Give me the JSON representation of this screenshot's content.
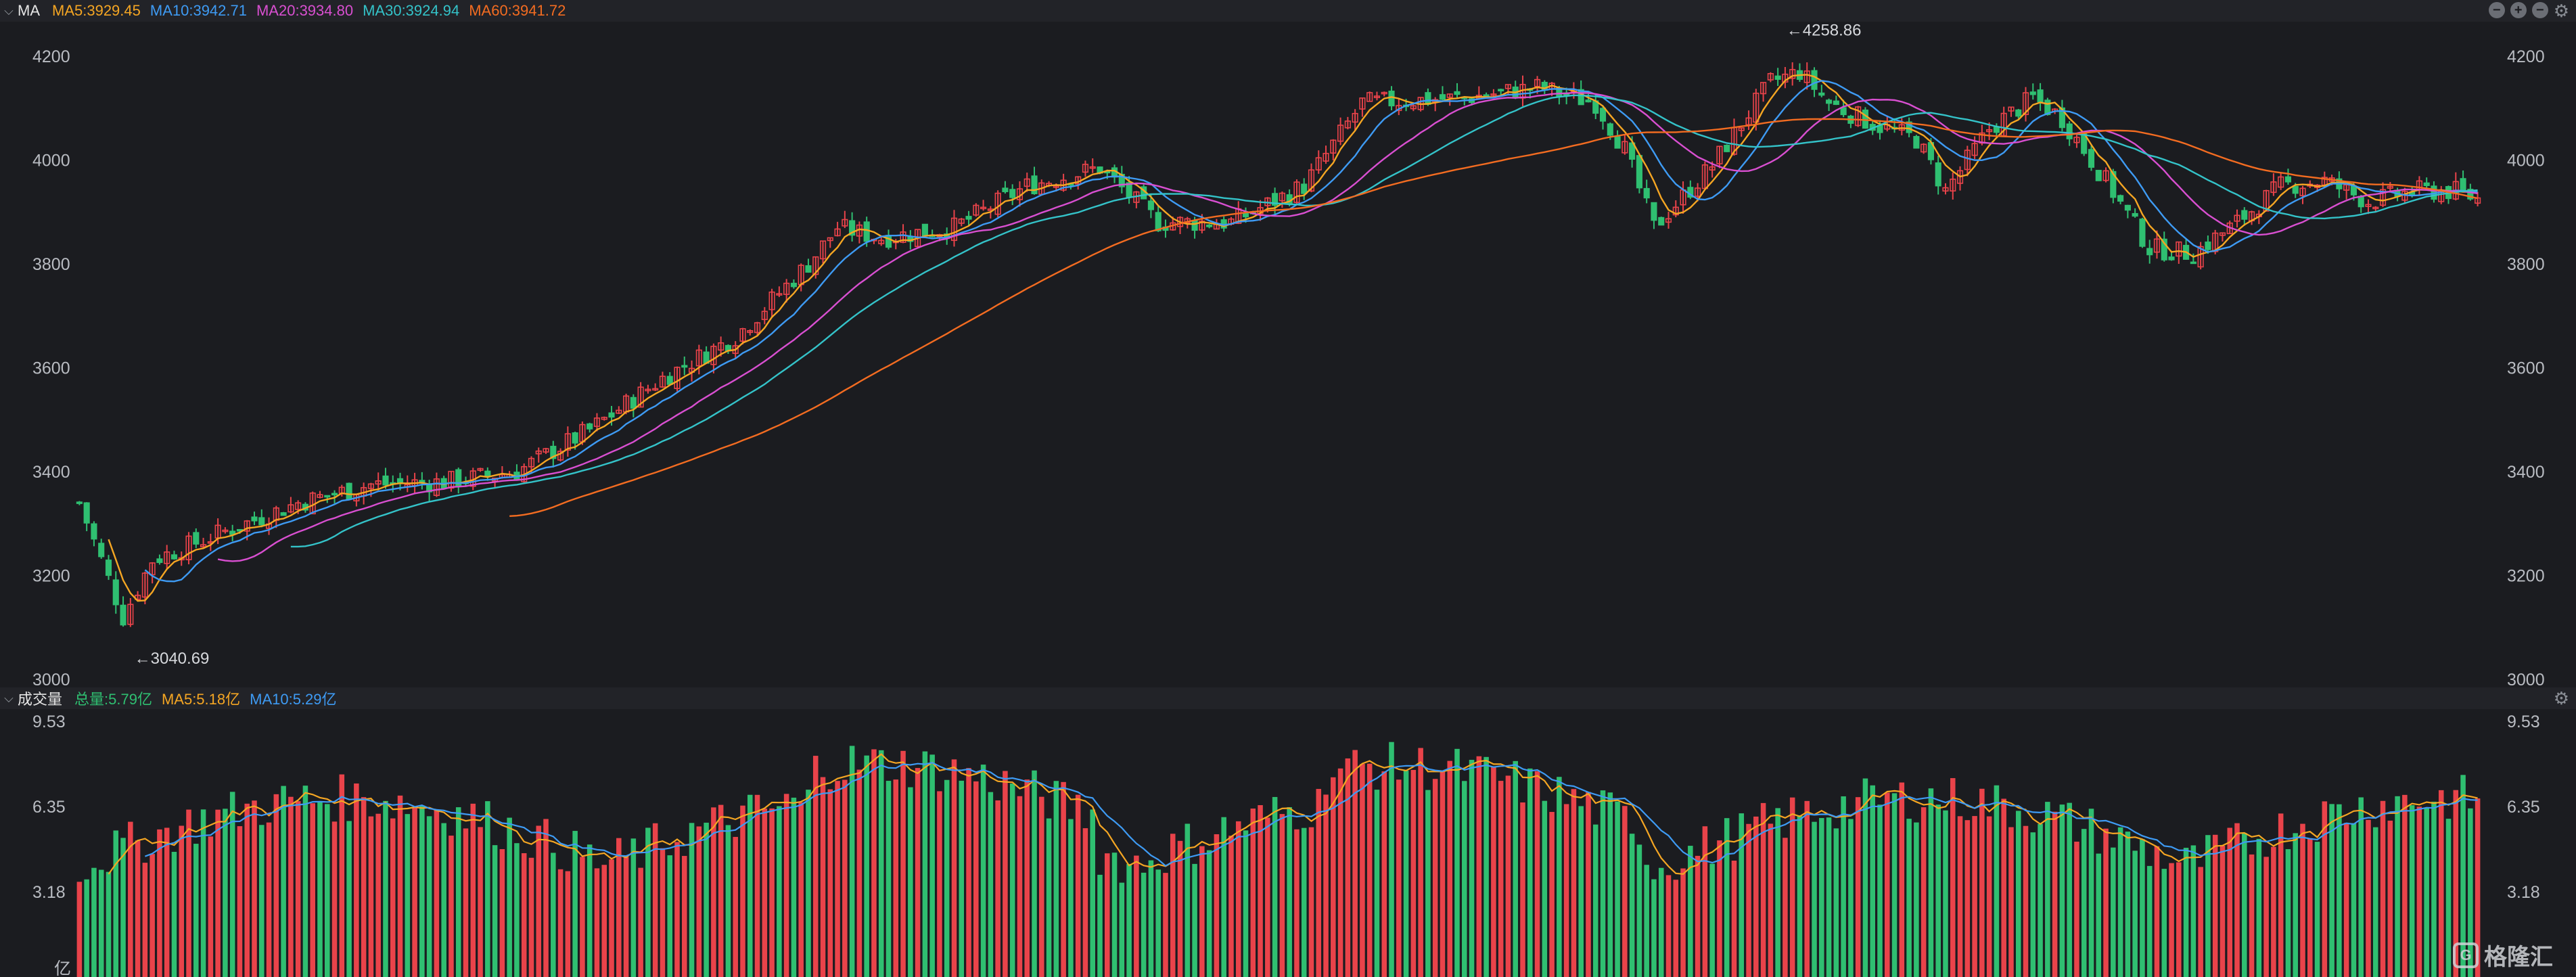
{
  "price_panel": {
    "indicator_name": "MA",
    "ma_readouts": [
      {
        "label": "MA5:3929.45",
        "color": "#f5a623"
      },
      {
        "label": "MA10:3942.71",
        "color": "#3e9bf4"
      },
      {
        "label": "MA20:3934.80",
        "color": "#d94fd1"
      },
      {
        "label": "MA30:3924.94",
        "color": "#34c3c9"
      },
      {
        "label": "MA60:3941.72",
        "color": "#f36c21"
      }
    ],
    "controls": [
      "collapse-icon",
      "add-icon",
      "minimize-icon",
      "settings-icon"
    ]
  },
  "volume_panel": {
    "indicator_name": "成交量",
    "ma_readouts": [
      {
        "label": "总量:5.79亿",
        "color": "#2fbf71"
      },
      {
        "label": "MA5:5.18亿",
        "color": "#f5a623"
      },
      {
        "label": "MA10:5.29亿",
        "color": "#3e9bf4"
      }
    ],
    "unit_label": "亿"
  },
  "watermark": {
    "text": "格隆汇",
    "logo_icon": "gelonghui-logo-icon"
  },
  "colors": {
    "up": "#e9434a",
    "down": "#2fbf71",
    "background": "#1b1c20",
    "header": "#222328"
  },
  "chart_data": [
    {
      "type": "candlestick",
      "title": "",
      "y_ticks": [
        "3000",
        "3200",
        "3400",
        "3600",
        "3800",
        "4000",
        "4200"
      ],
      "ylim": [
        3000,
        4250
      ],
      "x_count": 240,
      "annotations": [
        {
          "label": "←3040.69",
          "value": 3040.69,
          "kind": "low"
        },
        {
          "label": "←4258.86",
          "value": 4258.86,
          "kind": "high"
        }
      ],
      "close_path": [
        [
          0,
          3340
        ],
        [
          5,
          3335
        ],
        [
          8,
          3290
        ],
        [
          10,
          3120
        ],
        [
          12,
          3150
        ],
        [
          14,
          3190
        ],
        [
          17,
          3230
        ],
        [
          22,
          3260
        ],
        [
          28,
          3285
        ],
        [
          35,
          3310
        ],
        [
          42,
          3330
        ],
        [
          48,
          3380
        ],
        [
          53,
          3365
        ],
        [
          58,
          3360
        ],
        [
          63,
          3350
        ],
        [
          67,
          3370
        ],
        [
          72,
          3380
        ],
        [
          78,
          3375
        ],
        [
          83,
          3365
        ],
        [
          87,
          3380
        ],
        [
          92,
          3400
        ],
        [
          98,
          3420
        ],
        [
          105,
          3460
        ],
        [
          112,
          3510
        ],
        [
          118,
          3550
        ],
        [
          123,
          3590
        ],
        [
          128,
          3620
        ],
        [
          133,
          3660
        ],
        [
          138,
          3700
        ],
        [
          143,
          3760
        ],
        [
          148,
          3850
        ],
        [
          152,
          3880
        ],
        [
          156,
          3830
        ],
        [
          160,
          3840
        ],
        [
          164,
          3830
        ],
        [
          168,
          3845
        ],
        [
          172,
          3860
        ],
        [
          176,
          3880
        ],
        [
          180,
          3900
        ],
        [
          184,
          3960
        ],
        [
          188,
          3990
        ],
        [
          192,
          3970
        ],
        [
          196,
          4000
        ],
        [
          200,
          3990
        ],
        [
          204,
          3870
        ],
        [
          208,
          3890
        ],
        [
          212,
          3900
        ],
        [
          216,
          3880
        ],
        [
          220,
          3870
        ],
        [
          224,
          3900
        ],
        [
          228,
          3920
        ],
        [
          232,
          3960
        ],
        [
          236,
          4010
        ],
        [
          240,
          4140
        ]
      ],
      "close_path_note_removed": true,
      "series_ma": [
        {
          "name": "MA5",
          "color": "#f5a623"
        },
        {
          "name": "MA10",
          "color": "#3e9bf4"
        },
        {
          "name": "MA20",
          "color": "#d94fd1"
        },
        {
          "name": "MA30",
          "color": "#34c3c9"
        },
        {
          "name": "MA60",
          "color": "#f36c21"
        }
      ]
    },
    {
      "type": "bar",
      "title": "",
      "y_ticks": [
        "3.18",
        "6.35",
        "9.53"
      ],
      "ylim": [
        0,
        9.53
      ],
      "unit": "亿",
      "series_ma": [
        {
          "name": "MA5",
          "color": "#f5a623"
        },
        {
          "name": "MA10",
          "color": "#3e9bf4"
        }
      ]
    }
  ]
}
